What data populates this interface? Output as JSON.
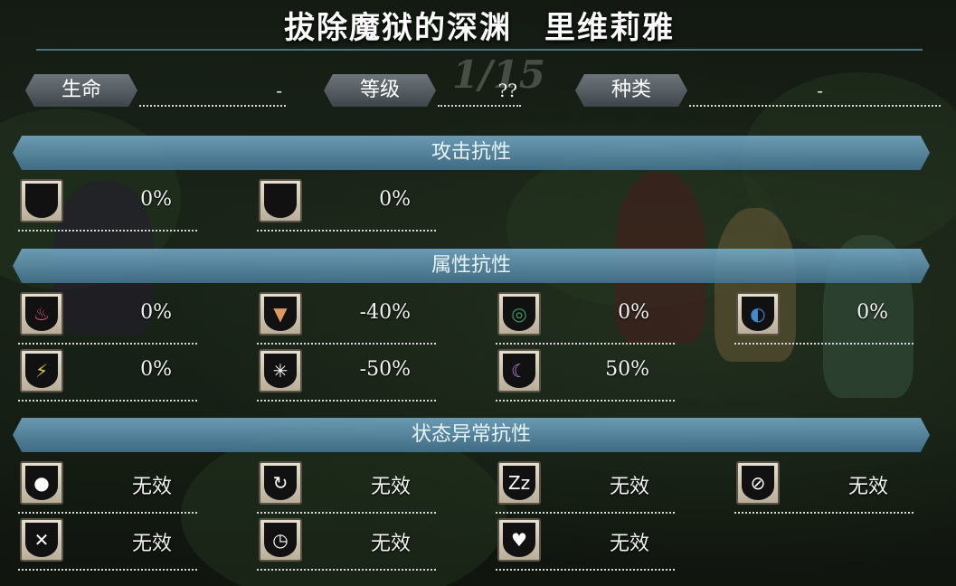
{
  "title": "拔除魔狱的深渊　里维莉雅",
  "watermark": "1/15",
  "stats": [
    {
      "label": "生命",
      "value": "-"
    },
    {
      "label": "等级",
      "value": "??"
    },
    {
      "label": "种类",
      "value": "-"
    }
  ],
  "sections": {
    "attack": "攻击抗性",
    "element": "属性抗性",
    "status": "状态异常抗性"
  },
  "attack_resist": [
    {
      "icon": "physical-attack-icon",
      "glyph": "!",
      "value": "0%",
      "color": "#111111"
    },
    {
      "icon": "magic-attack-icon",
      "glyph": "?",
      "value": "0%",
      "color": "#111111"
    }
  ],
  "element_resist": [
    {
      "icon": "fire-icon",
      "glyph": "♨",
      "value": "0%",
      "color": "#e05a7a"
    },
    {
      "icon": "earth-icon",
      "glyph": "▼",
      "value": "-40%",
      "color": "#e0975a"
    },
    {
      "icon": "wind-icon",
      "glyph": "◎",
      "value": "0%",
      "color": "#3e9c6a"
    },
    {
      "icon": "water-icon",
      "glyph": "◐",
      "value": "0%",
      "color": "#3c8ccf"
    },
    {
      "icon": "thunder-icon",
      "glyph": "⚡",
      "value": "0%",
      "color": "#d8d02a"
    },
    {
      "icon": "light-icon",
      "glyph": "✳",
      "value": "-50%",
      "color": "#ffffff"
    },
    {
      "icon": "dark-icon",
      "glyph": "☾",
      "value": "50%",
      "color": "#b98ce0"
    }
  ],
  "status_resist": [
    {
      "icon": "poison-icon",
      "glyph": "●",
      "value": "无效"
    },
    {
      "icon": "charm-icon",
      "glyph": "↻",
      "value": "无效"
    },
    {
      "icon": "sleep-icon",
      "glyph": "Zz",
      "value": "无效"
    },
    {
      "icon": "seal-icon",
      "glyph": "⊘",
      "value": "无效"
    },
    {
      "icon": "stun-icon",
      "glyph": "✕",
      "value": "无效"
    },
    {
      "icon": "stop-icon",
      "glyph": "◷",
      "value": "无效"
    },
    {
      "icon": "heart-icon",
      "glyph": "♥",
      "value": "无效"
    }
  ]
}
